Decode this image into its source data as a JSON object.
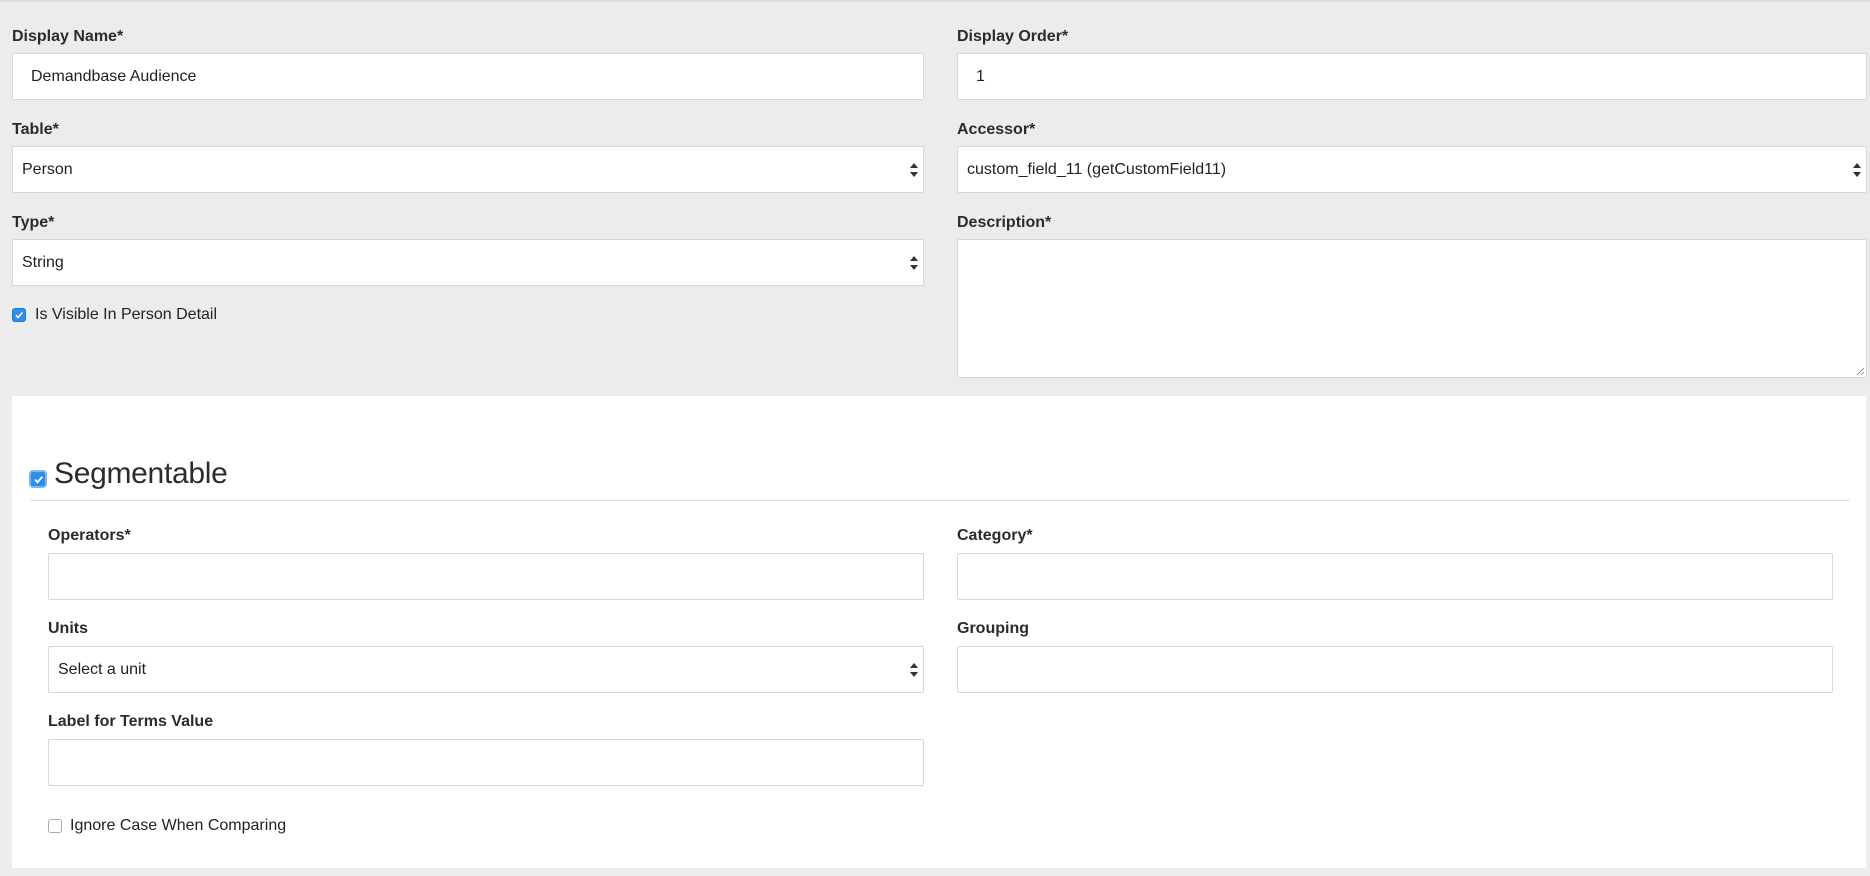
{
  "form": {
    "display_name": {
      "label": "Display Name*",
      "value": "Demandbase Audience"
    },
    "display_order": {
      "label": "Display Order*",
      "value": "1"
    },
    "table": {
      "label": "Table*",
      "selected": "Person"
    },
    "accessor": {
      "label": "Accessor*",
      "selected": "custom_field_11 (getCustomField11)"
    },
    "type": {
      "label": "Type*",
      "selected": "String"
    },
    "description": {
      "label": "Description*",
      "value": ""
    },
    "visible_in_person_detail": {
      "label": "Is Visible In Person Detail",
      "checked": true
    }
  },
  "segmentable": {
    "title": "Segmentable",
    "checked": true,
    "operators": {
      "label": "Operators*",
      "value": ""
    },
    "category": {
      "label": "Category*",
      "value": ""
    },
    "units": {
      "label": "Units",
      "selected": "Select a unit"
    },
    "grouping": {
      "label": "Grouping",
      "value": ""
    },
    "terms_label": {
      "label": "Label for Terms Value",
      "value": ""
    },
    "ignore_case": {
      "label": "Ignore Case When Comparing",
      "checked": false
    }
  },
  "colors": {
    "page_background": "#ececec",
    "panel_background": "#ffffff",
    "checkbox_accent": "#2f8ee8",
    "field_border": "#d7d7d7"
  },
  "icons": {
    "select_arrows": "updown-arrows-icon",
    "checkmark": "checkmark-icon",
    "resize_grip": "resize-grip-icon"
  }
}
